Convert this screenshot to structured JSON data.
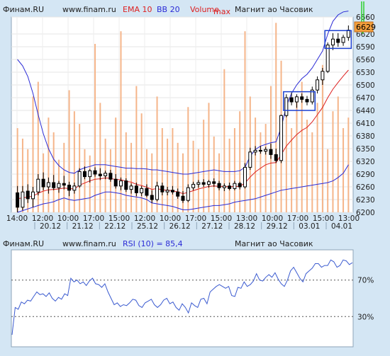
{
  "colors": {
    "background": "#d4e6f4",
    "plot_background": "#ffffff",
    "volume": "#f5b58a",
    "ema": "#dd1f1f",
    "bollinger": "#2b2bd6",
    "rsi": "#3b5bd0",
    "candle": "#000000",
    "marker_box": "#1a3fd0",
    "last_price_badge": "#f5a03c",
    "max_marker": "#2fd12f",
    "text": "#202020"
  },
  "chart_data": [
    {
      "type": "candlestick",
      "header": {
        "source": "Финам.RU",
        "site": "www.finam.ru",
        "ema_label": "EMA 10",
        "bb_label": "BB 20",
        "volume_label": "Volume",
        "max_label": "max",
        "instrument": "Магнит ао Часовик"
      },
      "last_price": "6629",
      "ylim": [
        6200,
        6660
      ],
      "y_ticks": [
        "6660",
        "6620",
        "6590",
        "6560",
        "6530",
        "6500",
        "6470",
        "6440",
        "6410",
        "6380",
        "6350",
        "6320",
        "6290",
        "6260",
        "6230",
        "6200"
      ],
      "y_tick_values": [
        6660,
        6620,
        6590,
        6560,
        6530,
        6500,
        6470,
        6440,
        6410,
        6380,
        6350,
        6320,
        6290,
        6260,
        6230,
        6200
      ],
      "time_labels": [
        "14:00",
        "12:00",
        "10:00",
        "17:00",
        "15:00",
        "12:00",
        "10:00",
        "17:00",
        "15:00",
        "13:00",
        "10:00",
        "17:00",
        "15:00",
        "13:00"
      ],
      "date_labels": [
        "20.12",
        "21.12",
        "22.12",
        "25.12",
        "26.12",
        "27.12",
        "28.12",
        "29.12",
        "03.01",
        "04.01"
      ],
      "candles": [
        {
          "o": 6246,
          "h": 6262,
          "l": 6200,
          "c": 6212
        },
        {
          "o": 6212,
          "h": 6262,
          "l": 6205,
          "c": 6248
        },
        {
          "o": 6250,
          "h": 6266,
          "l": 6222,
          "c": 6232
        },
        {
          "o": 6232,
          "h": 6260,
          "l": 6212,
          "c": 6248
        },
        {
          "o": 6248,
          "h": 6290,
          "l": 6240,
          "c": 6278
        },
        {
          "o": 6278,
          "h": 6294,
          "l": 6252,
          "c": 6260
        },
        {
          "o": 6260,
          "h": 6282,
          "l": 6244,
          "c": 6270
        },
        {
          "o": 6270,
          "h": 6288,
          "l": 6252,
          "c": 6258
        },
        {
          "o": 6258,
          "h": 6274,
          "l": 6246,
          "c": 6268
        },
        {
          "o": 6268,
          "h": 6286,
          "l": 6254,
          "c": 6264
        },
        {
          "o": 6264,
          "h": 6272,
          "l": 6238,
          "c": 6252
        },
        {
          "o": 6252,
          "h": 6270,
          "l": 6244,
          "c": 6262
        },
        {
          "o": 6262,
          "h": 6304,
          "l": 6258,
          "c": 6296
        },
        {
          "o": 6296,
          "h": 6308,
          "l": 6278,
          "c": 6284
        },
        {
          "o": 6284,
          "h": 6302,
          "l": 6270,
          "c": 6298
        },
        {
          "o": 6298,
          "h": 6306,
          "l": 6284,
          "c": 6290
        },
        {
          "o": 6290,
          "h": 6304,
          "l": 6276,
          "c": 6286
        },
        {
          "o": 6286,
          "h": 6298,
          "l": 6278,
          "c": 6292
        },
        {
          "o": 6292,
          "h": 6300,
          "l": 6272,
          "c": 6278
        },
        {
          "o": 6278,
          "h": 6290,
          "l": 6256,
          "c": 6262
        },
        {
          "o": 6262,
          "h": 6282,
          "l": 6252,
          "c": 6274
        },
        {
          "o": 6274,
          "h": 6280,
          "l": 6248,
          "c": 6254
        },
        {
          "o": 6254,
          "h": 6268,
          "l": 6244,
          "c": 6262
        },
        {
          "o": 6262,
          "h": 6270,
          "l": 6238,
          "c": 6246
        },
        {
          "o": 6246,
          "h": 6262,
          "l": 6238,
          "c": 6256
        },
        {
          "o": 6256,
          "h": 6266,
          "l": 6236,
          "c": 6240
        },
        {
          "o": 6240,
          "h": 6252,
          "l": 6222,
          "c": 6230
        },
        {
          "o": 6230,
          "h": 6272,
          "l": 6226,
          "c": 6262
        },
        {
          "o": 6262,
          "h": 6270,
          "l": 6240,
          "c": 6248
        },
        {
          "o": 6248,
          "h": 6260,
          "l": 6240,
          "c": 6252
        },
        {
          "o": 6252,
          "h": 6262,
          "l": 6242,
          "c": 6248
        },
        {
          "o": 6248,
          "h": 6256,
          "l": 6232,
          "c": 6238
        },
        {
          "o": 6238,
          "h": 6250,
          "l": 6222,
          "c": 6228
        },
        {
          "o": 6228,
          "h": 6266,
          "l": 6224,
          "c": 6258
        },
        {
          "o": 6258,
          "h": 6272,
          "l": 6252,
          "c": 6266
        },
        {
          "o": 6266,
          "h": 6276,
          "l": 6258,
          "c": 6270
        },
        {
          "o": 6270,
          "h": 6278,
          "l": 6260,
          "c": 6266
        },
        {
          "o": 6266,
          "h": 6276,
          "l": 6258,
          "c": 6272
        },
        {
          "o": 6272,
          "h": 6280,
          "l": 6260,
          "c": 6268
        },
        {
          "o": 6268,
          "h": 6274,
          "l": 6252,
          "c": 6258
        },
        {
          "o": 6258,
          "h": 6268,
          "l": 6250,
          "c": 6262
        },
        {
          "o": 6262,
          "h": 6270,
          "l": 6252,
          "c": 6256
        },
        {
          "o": 6256,
          "h": 6274,
          "l": 6252,
          "c": 6268
        },
        {
          "o": 6268,
          "h": 6272,
          "l": 6254,
          "c": 6260
        },
        {
          "o": 6260,
          "h": 6316,
          "l": 6256,
          "c": 6306
        },
        {
          "o": 6306,
          "h": 6352,
          "l": 6300,
          "c": 6342
        },
        {
          "o": 6342,
          "h": 6356,
          "l": 6334,
          "c": 6346
        },
        {
          "o": 6346,
          "h": 6356,
          "l": 6338,
          "c": 6344
        },
        {
          "o": 6344,
          "h": 6354,
          "l": 6336,
          "c": 6348
        },
        {
          "o": 6348,
          "h": 6362,
          "l": 6326,
          "c": 6336
        },
        {
          "o": 6336,
          "h": 6350,
          "l": 6316,
          "c": 6322
        },
        {
          "o": 6322,
          "h": 6430,
          "l": 6316,
          "c": 6428
        },
        {
          "o": 6428,
          "h": 6478,
          "l": 6424,
          "c": 6470
        },
        {
          "o": 6470,
          "h": 6482,
          "l": 6452,
          "c": 6460
        },
        {
          "o": 6460,
          "h": 6478,
          "l": 6446,
          "c": 6472
        },
        {
          "o": 6472,
          "h": 6480,
          "l": 6458,
          "c": 6466
        },
        {
          "o": 6466,
          "h": 6474,
          "l": 6452,
          "c": 6460
        },
        {
          "o": 6460,
          "h": 6496,
          "l": 6454,
          "c": 6488
        },
        {
          "o": 6488,
          "h": 6520,
          "l": 6480,
          "c": 6512
        },
        {
          "o": 6512,
          "h": 6540,
          "l": 6500,
          "c": 6532
        },
        {
          "o": 6532,
          "h": 6600,
          "l": 6528,
          "c": 6594
        },
        {
          "o": 6594,
          "h": 6622,
          "l": 6582,
          "c": 6608
        },
        {
          "o": 6608,
          "h": 6622,
          "l": 6590,
          "c": 6600
        },
        {
          "o": 6600,
          "h": 6618,
          "l": 6592,
          "c": 6612
        },
        {
          "o": 6612,
          "h": 6640,
          "l": 6604,
          "c": 6629
        }
      ],
      "volume": [
        40,
        35,
        30,
        55,
        62,
        28,
        45,
        38,
        25,
        33,
        58,
        48,
        42,
        30,
        27,
        80,
        52,
        35,
        30,
        45,
        86,
        38,
        33,
        60,
        47,
        30,
        28,
        55,
        40,
        35,
        40,
        33,
        28,
        50,
        34,
        30,
        44,
        52,
        36,
        28,
        68,
        35,
        40,
        48,
        86,
        55,
        45,
        38,
        42,
        60,
        90,
        72,
        50,
        40,
        55,
        62,
        44,
        38,
        52,
        70,
        30,
        48,
        55,
        40,
        45
      ],
      "ema": [
        6232,
        6234,
        6236,
        6238,
        6245,
        6250,
        6253,
        6254,
        6255,
        6257,
        6256,
        6255,
        6264,
        6269,
        6274,
        6278,
        6279,
        6281,
        6280,
        6277,
        6277,
        6273,
        6271,
        6266,
        6263,
        6259,
        6254,
        6256,
        6253,
        6252,
        6251,
        6248,
        6244,
        6247,
        6251,
        6255,
        6258,
        6261,
        6262,
        6261,
        6261,
        6260,
        6261,
        6261,
        6269,
        6283,
        6295,
        6304,
        6312,
        6316,
        6317,
        6336,
        6356,
        6370,
        6383,
        6393,
        6400,
        6413,
        6430,
        6447,
        6470,
        6490,
        6506,
        6521,
        6535
      ],
      "bb_upper": [
        6560,
        6545,
        6520,
        6480,
        6430,
        6385,
        6350,
        6325,
        6310,
        6300,
        6294,
        6292,
        6300,
        6305,
        6308,
        6312,
        6312,
        6312,
        6310,
        6308,
        6306,
        6304,
        6304,
        6303,
        6303,
        6302,
        6300,
        6300,
        6298,
        6296,
        6294,
        6292,
        6290,
        6290,
        6292,
        6294,
        6296,
        6298,
        6300,
        6298,
        6296,
        6296,
        6296,
        6298,
        6306,
        6332,
        6348,
        6356,
        6360,
        6364,
        6366,
        6400,
        6450,
        6480,
        6500,
        6515,
        6525,
        6540,
        6560,
        6580,
        6620,
        6650,
        6665,
        6672,
        6678
      ],
      "bb_lower": [
        6200,
        6204,
        6208,
        6212,
        6216,
        6220,
        6222,
        6225,
        6230,
        6234,
        6230,
        6228,
        6230,
        6232,
        6234,
        6240,
        6244,
        6248,
        6248,
        6246,
        6244,
        6240,
        6238,
        6236,
        6234,
        6230,
        6222,
        6220,
        6218,
        6216,
        6214,
        6210,
        6206,
        6206,
        6208,
        6210,
        6212,
        6214,
        6216,
        6216,
        6218,
        6220,
        6224,
        6226,
        6228,
        6230,
        6232,
        6236,
        6240,
        6244,
        6248,
        6252,
        6254,
        6256,
        6258,
        6260,
        6262,
        6264,
        6266,
        6268,
        6270,
        6274,
        6282,
        6292,
        6312
      ],
      "highlight_boxes": [
        {
          "from": 52,
          "to": 57,
          "low": 6440,
          "high": 6484
        },
        {
          "from": 60,
          "to": 64,
          "low": 6586,
          "high": 6628
        }
      ]
    },
    {
      "type": "line",
      "header": {
        "source": "Финам.RU",
        "site": "www.finam.ru",
        "indicator_label": "RSI (10) = 85,4",
        "instrument": "Магнит ао Часовик"
      },
      "ylim": [
        0,
        100
      ],
      "levels": [
        70,
        30
      ],
      "level_labels": [
        "70%",
        "30%"
      ],
      "values": [
        10,
        40,
        38,
        46,
        44,
        48,
        47,
        52,
        57,
        54,
        55,
        52,
        56,
        50,
        47,
        51,
        49,
        55,
        53,
        72,
        68,
        70,
        66,
        68,
        64,
        69,
        72,
        66,
        65,
        62,
        66,
        57,
        50,
        43,
        45,
        41,
        43,
        42,
        45,
        49,
        48,
        42,
        40,
        45,
        47,
        49,
        43,
        40,
        43,
        48,
        50,
        44,
        46,
        40,
        37,
        44,
        40,
        34,
        45,
        42,
        40,
        49,
        50,
        44,
        57,
        60,
        63,
        65,
        63,
        61,
        63,
        53,
        52,
        62,
        61,
        68,
        63,
        65,
        69,
        77,
        70,
        69,
        73,
        76,
        73,
        78,
        71,
        66,
        63,
        70,
        80,
        84,
        78,
        72,
        68,
        77,
        80,
        83,
        88,
        88,
        84,
        86,
        86,
        92,
        90,
        84,
        86,
        92,
        91,
        87,
        89
      ],
      "rsi_value_text": "85,4"
    }
  ]
}
